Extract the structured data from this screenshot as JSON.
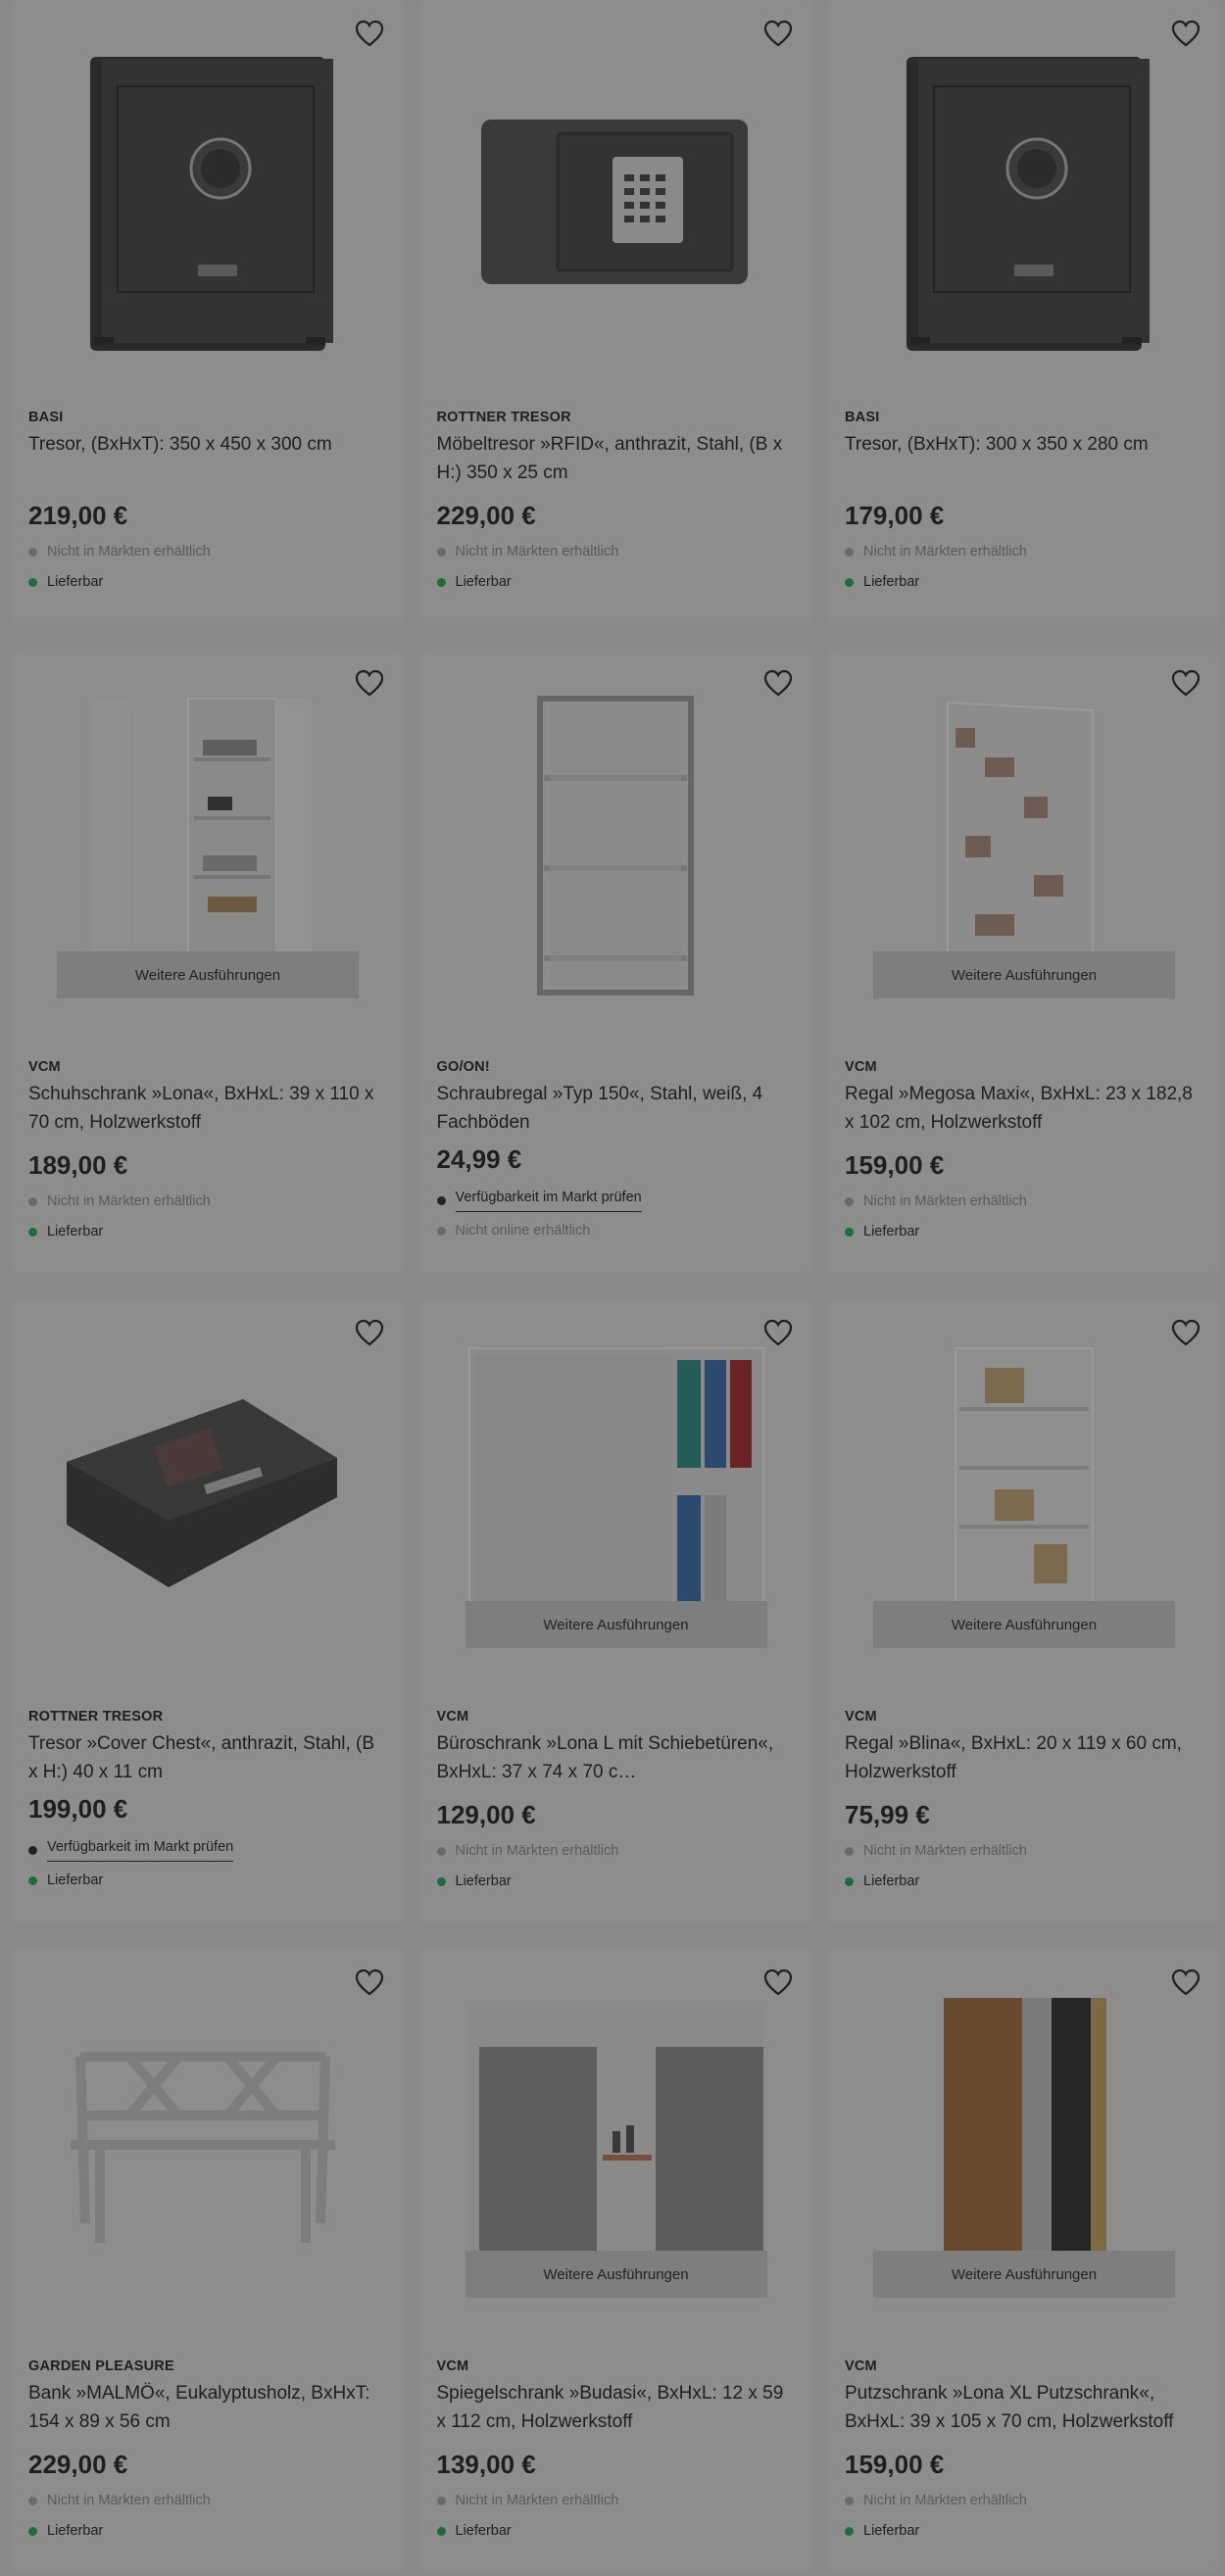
{
  "products": [
    {
      "brand": "BASI",
      "title": "Tresor, (BxHxT): 350 x 450 x 300 cm",
      "price": "219,00 €",
      "availability": [
        {
          "text": "Nicht in Märkten erhältlich",
          "kind": "muted"
        },
        {
          "text": "Lieferbar",
          "kind": "ok"
        }
      ],
      "image_icon": "safe-icon",
      "variants_label": ""
    },
    {
      "brand": "ROTTNER TRESOR",
      "title": "Möbeltresor »RFID«, anthrazit, Stahl, (B x H:) 350 x 25 cm",
      "price": "229,00 €",
      "availability": [
        {
          "text": "Nicht in Märkten erhältlich",
          "kind": "muted"
        },
        {
          "text": "Lieferbar",
          "kind": "ok"
        }
      ],
      "image_icon": "keypad-safe-icon",
      "variants_label": ""
    },
    {
      "brand": "BASI",
      "title": "Tresor, (BxHxT): 300 x 350 x 280 cm",
      "price": "179,00 €",
      "availability": [
        {
          "text": "Nicht in Märkten erhältlich",
          "kind": "muted"
        },
        {
          "text": "Lieferbar",
          "kind": "ok"
        }
      ],
      "image_icon": "safe-icon",
      "variants_label": ""
    },
    {
      "brand": "VCM",
      "title": "Schuhschrank »Lona«, BxHxL: 39 x 110 x 70 cm, Holzwerkstoff",
      "price": "189,00 €",
      "availability": [
        {
          "text": "Nicht in Märkten erhältlich",
          "kind": "muted"
        },
        {
          "text": "Lieferbar",
          "kind": "ok"
        }
      ],
      "image_icon": "shoe-cabinet-icon",
      "variants_label": "Weitere Ausführungen"
    },
    {
      "brand": "GO/ON!",
      "title": "Schraubregal »Typ 150«, Stahl, weiß, 4 Fachböden",
      "price": "24,99 €",
      "availability": [
        {
          "text": "Verfügbarkeit im Markt prüfen",
          "kind": "link"
        },
        {
          "text": "Nicht online erhältlich",
          "kind": "muted"
        }
      ],
      "image_icon": "steel-shelf-icon",
      "variants_label": ""
    },
    {
      "brand": "VCM",
      "title": "Regal »Megosa Maxi«, BxHxL: 23 x 182,8 x 102 cm, Holzwerkstoff",
      "price": "159,00 €",
      "availability": [
        {
          "text": "Nicht in Märkten erhältlich",
          "kind": "muted"
        },
        {
          "text": "Lieferbar",
          "kind": "ok"
        }
      ],
      "image_icon": "bookshelf-icon",
      "variants_label": "Weitere Ausführungen"
    },
    {
      "brand": "ROTTNER TRESOR",
      "title": "Tresor »Cover Chest«, anthrazit, Stahl, (B x H:) 40 x 11 cm",
      "price": "199,00 €",
      "availability": [
        {
          "text": "Verfügbarkeit im Markt prüfen",
          "kind": "link"
        },
        {
          "text": "Lieferbar",
          "kind": "ok"
        }
      ],
      "image_icon": "chest-safe-icon",
      "variants_label": ""
    },
    {
      "brand": "VCM",
      "title": "Büroschrank »Lona L mit Schiebetüren«, BxHxL: 37 x 74 x 70 c…",
      "price": "129,00 €",
      "availability": [
        {
          "text": "Nicht in Märkten erhältlich",
          "kind": "muted"
        },
        {
          "text": "Lieferbar",
          "kind": "ok"
        }
      ],
      "image_icon": "office-cabinet-icon",
      "variants_label": "Weitere Ausführungen"
    },
    {
      "brand": "VCM",
      "title": "Regal »Blina«, BxHxL: 20 x 119 x 60 cm, Holzwerkstoff",
      "price": "75,99 €",
      "availability": [
        {
          "text": "Nicht in Märkten erhältlich",
          "kind": "muted"
        },
        {
          "text": "Lieferbar",
          "kind": "ok"
        }
      ],
      "image_icon": "shelf-icon",
      "variants_label": "Weitere Ausführungen"
    },
    {
      "brand": "GARDEN PLEASURE",
      "title": "Bank »MALMÖ«, Eukalyptusholz, BxHxT: 154 x 89 x 56 cm",
      "price": "229,00 €",
      "availability": [
        {
          "text": "Nicht in Märkten erhältlich",
          "kind": "muted"
        },
        {
          "text": "Lieferbar",
          "kind": "ok"
        }
      ],
      "image_icon": "garden-bench-icon",
      "variants_label": ""
    },
    {
      "brand": "VCM",
      "title": "Spiegelschrank »Budasi«, BxHxL: 12 x 59 x 112 cm, Holzwerkstoff",
      "price": "139,00 €",
      "availability": [
        {
          "text": "Nicht in Märkten erhältlich",
          "kind": "muted"
        },
        {
          "text": "Lieferbar",
          "kind": "ok"
        }
      ],
      "image_icon": "mirror-cabinet-icon",
      "variants_label": "Weitere Ausführungen"
    },
    {
      "brand": "VCM",
      "title": "Putzschrank »Lona XL Putzschrank«, BxHxL: 39 x 105 x 70 cm, Holzwerkstoff",
      "price": "159,00 €",
      "availability": [
        {
          "text": "Nicht in Märkten erhältlich",
          "kind": "muted"
        },
        {
          "text": "Lieferbar",
          "kind": "ok"
        }
      ],
      "image_icon": "cleaning-cabinet-icon",
      "variants_label": "Weitere Ausführungen"
    }
  ],
  "colors": {
    "overlay_bg": "#8a8a8a",
    "in_stock_dot": "#1f6b3d",
    "muted_dot": "#6a6a6a"
  }
}
